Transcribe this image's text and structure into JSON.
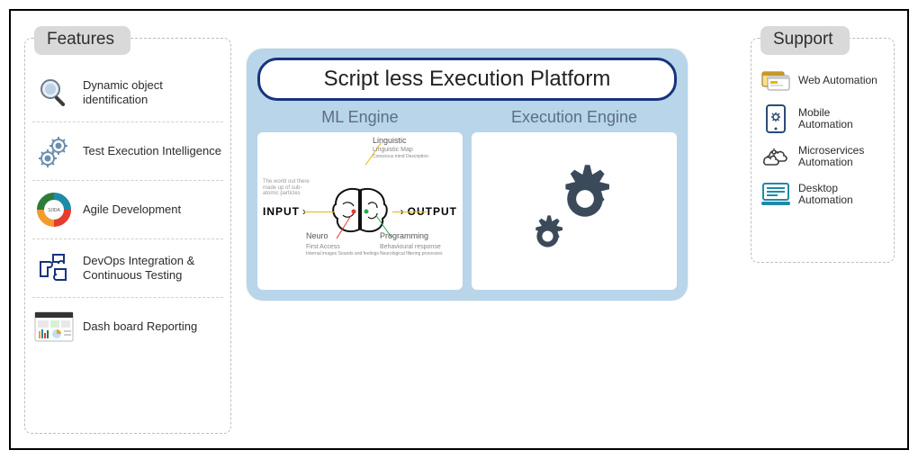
{
  "features": {
    "title": "Features",
    "items": [
      {
        "icon": "magnifier-icon",
        "label": "Dynamic object identification"
      },
      {
        "icon": "gears-icon",
        "label": "Test Execution Intelligence"
      },
      {
        "icon": "agile-icon",
        "label": "Agile Development"
      },
      {
        "icon": "puzzle-icon",
        "label": "DevOps Integration & Continuous Testing"
      },
      {
        "icon": "dashboard-icon",
        "label": "Dash board Reporting"
      }
    ]
  },
  "support": {
    "title": "Support",
    "items": [
      {
        "icon": "web-icon",
        "label": "Web Automation"
      },
      {
        "icon": "mobile-icon",
        "label": "Mobile Automation"
      },
      {
        "icon": "cloud-icon",
        "label": "Microservices Automation"
      },
      {
        "icon": "desktop-icon",
        "label": "Desktop Automation"
      }
    ]
  },
  "platform": {
    "title": "Script less Execution Platform",
    "ml": {
      "title": "ML Engine",
      "input_label": "INPUT",
      "output_label": "OUTPUT",
      "input_note": "The world out there made up of sub-atomic particles",
      "output_note": "",
      "labels": {
        "linguistic": "Linguistic",
        "linguistic_map": "Linguistic Map",
        "linguistic_sub": "Conscious mind Description",
        "neuro": "Neuro",
        "first_access": "First Access",
        "first_access_sub": "Internal images Sounds and feelings",
        "programming": "Programming",
        "behavioural": "Behavioural response",
        "behavioural_sub": "Neurological filtering processes"
      }
    },
    "exec": {
      "title": "Execution Engine"
    }
  },
  "colors": {
    "card_bg": "#b8d5ea",
    "pill_border": "#16337f",
    "gear": "#3b4a5a",
    "badge_bg": "#d9d9d9"
  }
}
